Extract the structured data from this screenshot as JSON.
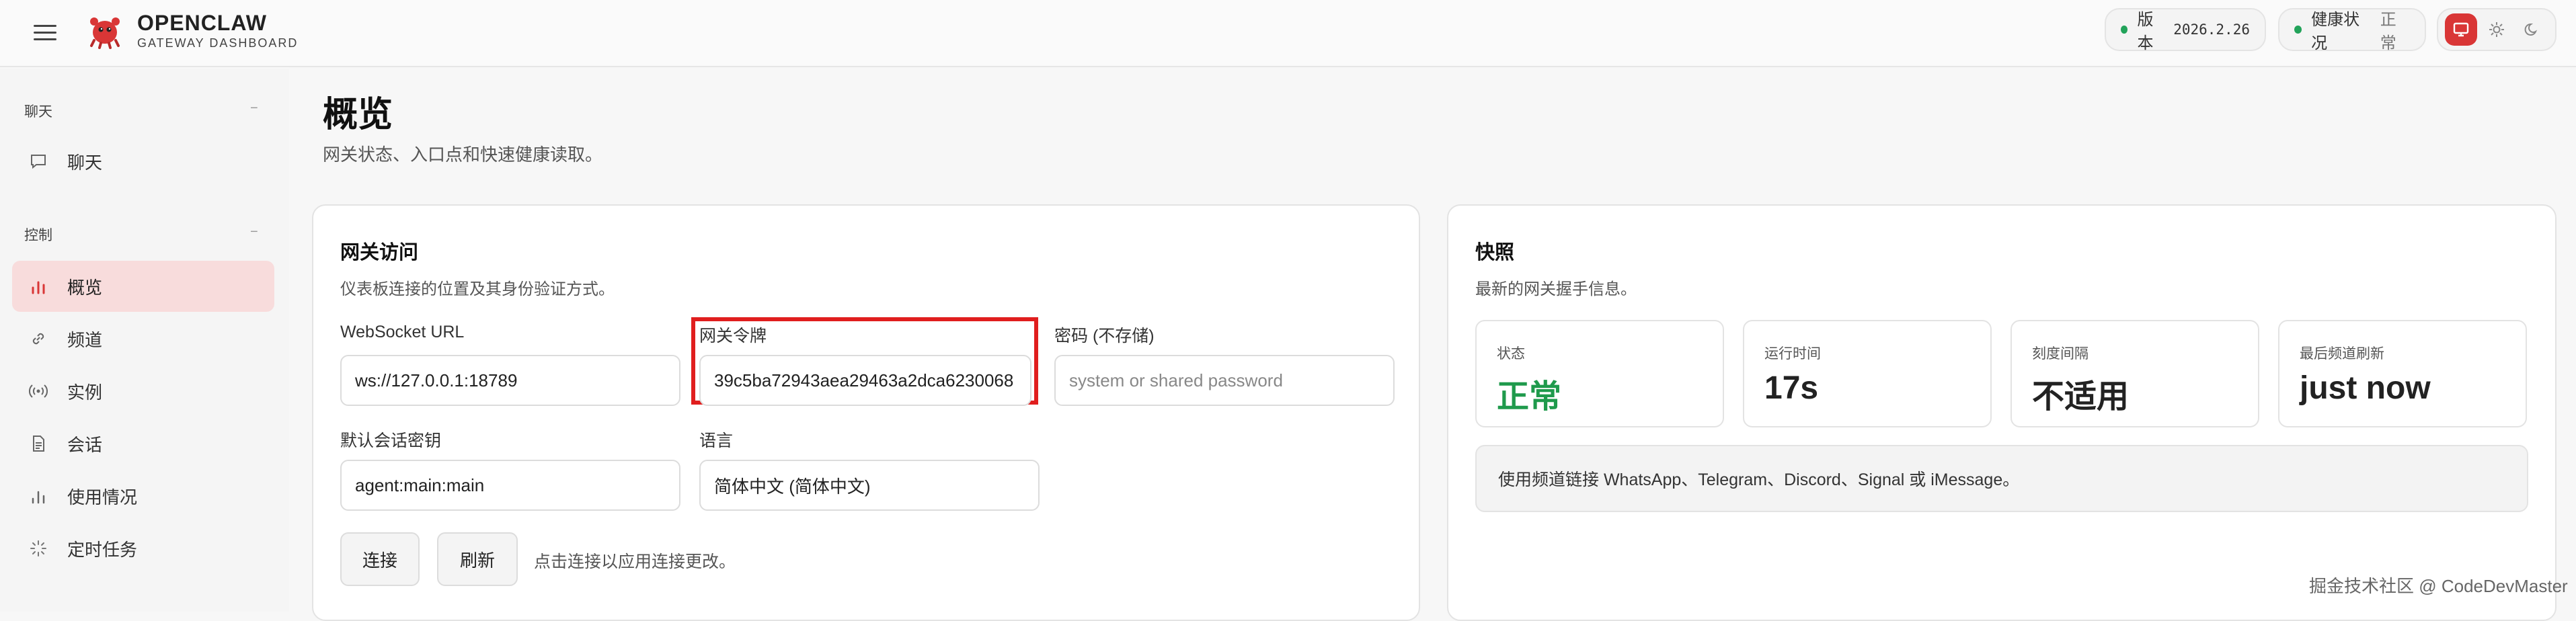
{
  "brand": {
    "title": "OPENCLAW",
    "subtitle": "GATEWAY DASHBOARD"
  },
  "header": {
    "version_label": "版本",
    "version_value": "2026.2.26",
    "health_label": "健康状况",
    "health_value": "正常",
    "status_color": "#22a35a",
    "accent_color": "#d93636"
  },
  "sidebar": {
    "sections": [
      {
        "label": "聊天",
        "collapse_glyph": "−",
        "items": [
          {
            "label": "聊天",
            "icon": "chat-icon"
          }
        ]
      },
      {
        "label": "控制",
        "collapse_glyph": "−",
        "items": [
          {
            "label": "概览",
            "icon": "bar-chart-icon",
            "active": true
          },
          {
            "label": "频道",
            "icon": "link-icon"
          },
          {
            "label": "实例",
            "icon": "broadcast-icon"
          },
          {
            "label": "会话",
            "icon": "document-icon"
          },
          {
            "label": "使用情况",
            "icon": "usage-chart-icon"
          },
          {
            "label": "定时任务",
            "icon": "loader-icon"
          }
        ]
      }
    ]
  },
  "main": {
    "title": "概览",
    "subtitle": "网关状态、入口点和快速健康读取。"
  },
  "gateway_access": {
    "title": "网关访问",
    "subtitle": "仪表板连接的位置及其身份验证方式。",
    "websocket_label": "WebSocket URL",
    "websocket_value": "ws://127.0.0.1:18789",
    "token_label": "网关令牌",
    "token_value": "39c5ba72943aea29463a2dca6230068",
    "password_label": "密码 (不存储)",
    "password_placeholder": "system or shared password",
    "session_label": "默认会话密钥",
    "session_value": "agent:main:main",
    "language_label": "语言",
    "language_value": "简体中文 (简体中文)",
    "connect_button": "连接",
    "refresh_button": "刷新",
    "hint": "点击连接以应用连接更改。"
  },
  "snapshot": {
    "title": "快照",
    "subtitle": "最新的网关握手信息。",
    "stats": [
      {
        "label": "状态",
        "value": "正常",
        "ok": true
      },
      {
        "label": "运行时间",
        "value": "17s"
      },
      {
        "label": "刻度间隔",
        "value": "不适用"
      },
      {
        "label": "最后频道刷新",
        "value": "just now"
      }
    ],
    "note": "使用频道链接 WhatsApp、Telegram、Discord、Signal 或 iMessage。"
  },
  "watermark": "掘金技术社区 @ CodeDevMaster"
}
